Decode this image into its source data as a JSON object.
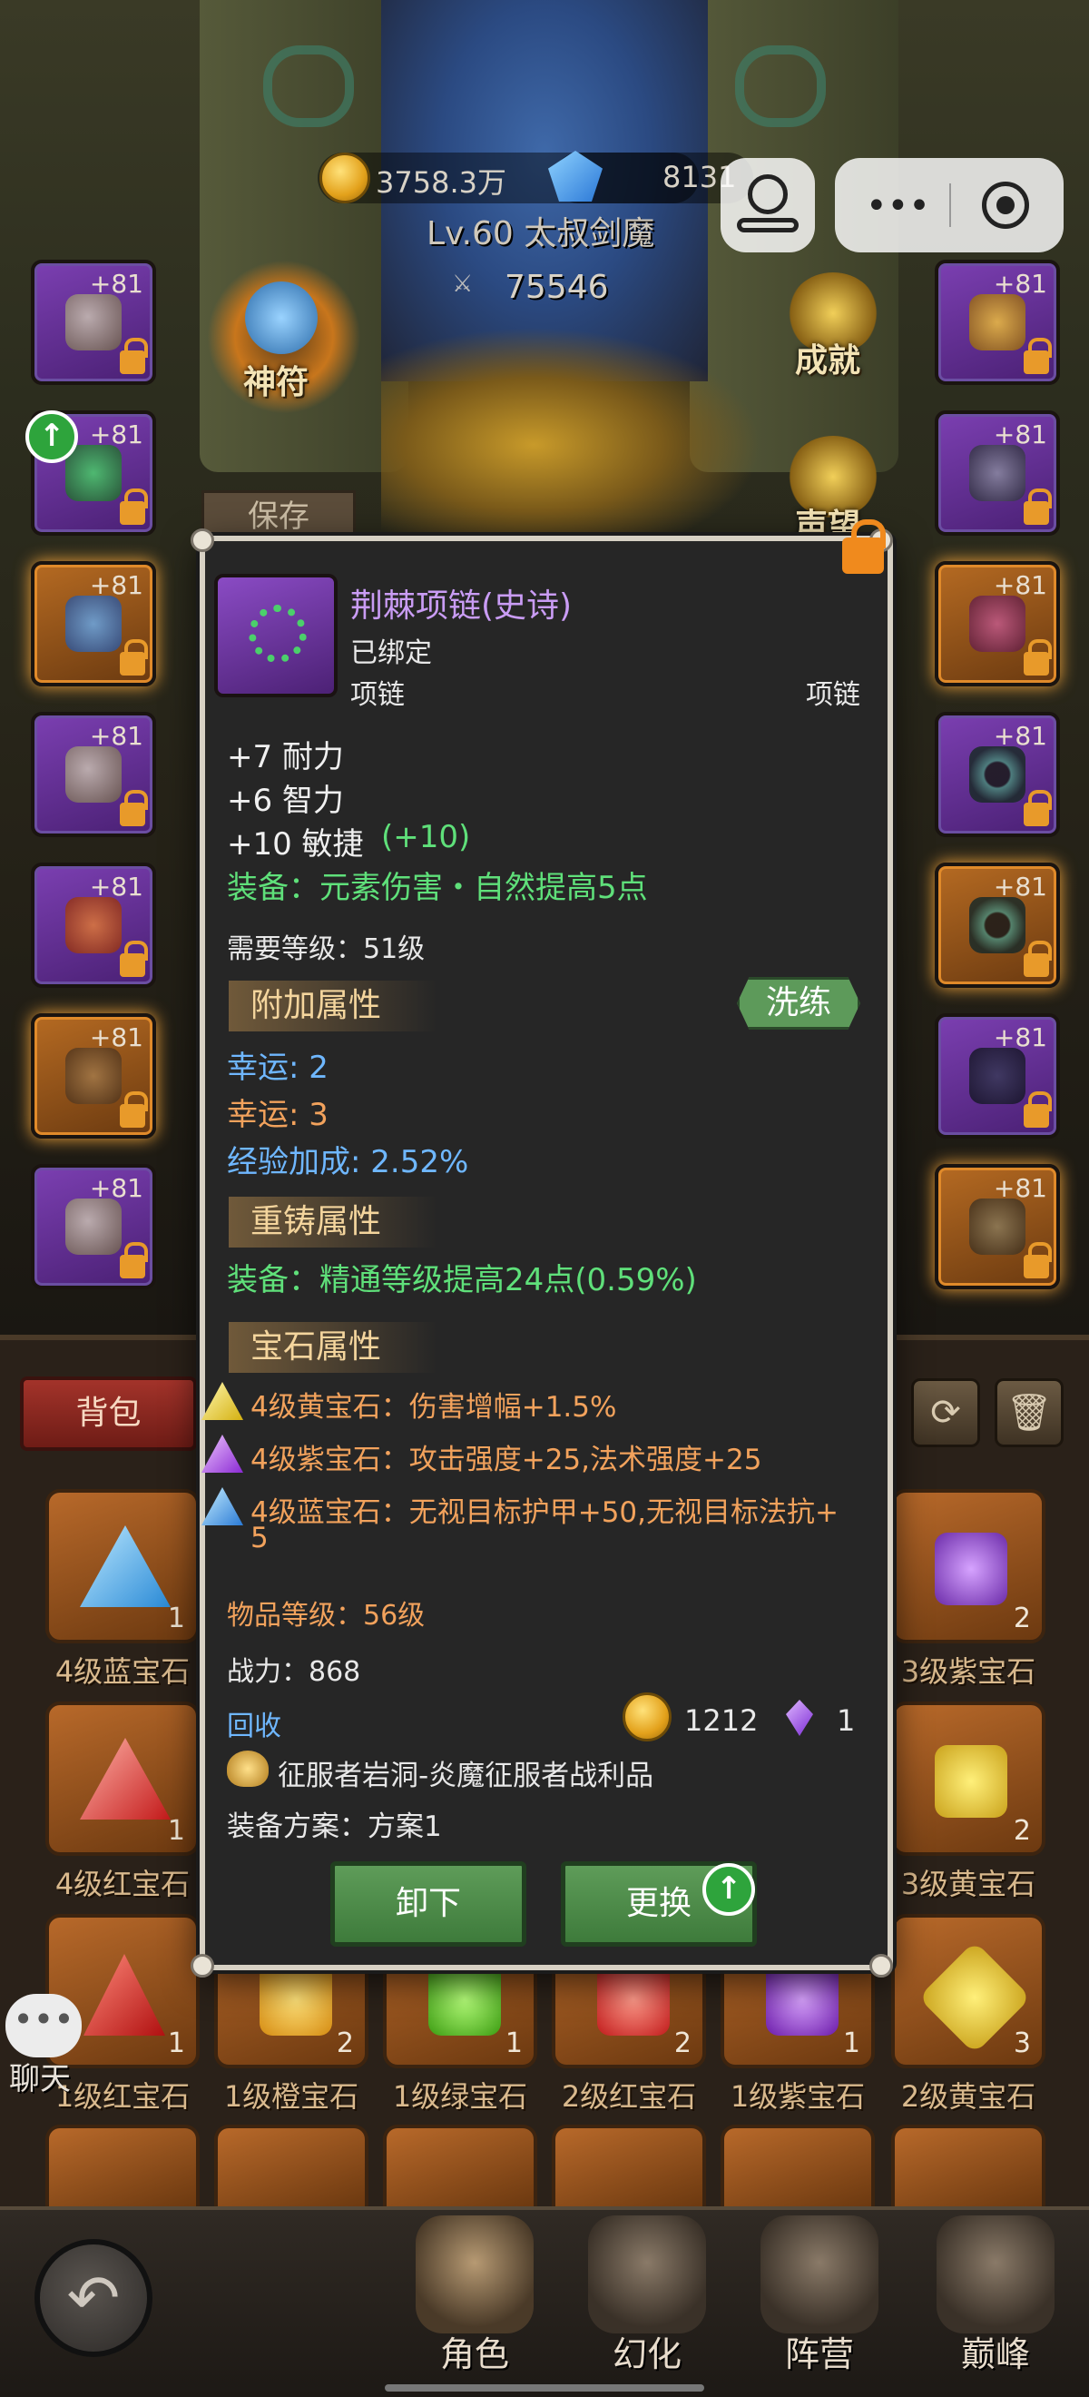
{
  "header": {
    "gold": "3758.3万",
    "gems": "8131",
    "character": "Lv.60 太叔剑魔",
    "power": "75546"
  },
  "side_buttons": {
    "rune": "神符",
    "save": "保存",
    "achievement": "成就",
    "reputation": "声望"
  },
  "slots_left": [
    "+81",
    "+81",
    "+81",
    "+81",
    "+81",
    "+81",
    "+81"
  ],
  "slots_right": [
    "+81",
    "+81",
    "+81",
    "+81",
    "+81",
    "+81",
    "+81"
  ],
  "tooltip": {
    "name": "荆棘项链(史诗)",
    "bound": "已绑定",
    "type_left": "项链",
    "type_right": "项链",
    "stats": [
      "+7 耐力",
      "+6 智力",
      "+10 敏捷"
    ],
    "stat_bonus": "(+10)",
    "equip_effect": "装备：元素伤害・自然提高5点",
    "required_level": "需要等级：51级",
    "extra_attr_title": "附加属性",
    "refine_button": "洗练",
    "extra_attrs": [
      "幸运: 2",
      "幸运: 3",
      "经验加成: 2.52%"
    ],
    "recast_title": "重铸属性",
    "recast_effect": "装备：精通等级提高24点(0.59%)",
    "gem_title": "宝石属性",
    "gems": [
      "4级黄宝石：伤害增幅+1.5%",
      "4级紫宝石：攻击强度+25,法术强度+25",
      "4级蓝宝石：无视目标护甲+50,无视目标法抗+",
      "5"
    ],
    "item_level": "物品等级：56级",
    "combat_power": "战力：868",
    "recycle": "回收",
    "recycle_gold": "1212",
    "recycle_crystal": "1",
    "source": "征服者岩洞-炎魔征服者战利品",
    "plan": "装备方案：方案1",
    "unequip_button": "卸下",
    "replace_button": "更换"
  },
  "inventory": {
    "tab": "背包",
    "row1": [
      {
        "name": "4级蓝宝石",
        "count": "1"
      },
      {
        "name": "3级紫宝石",
        "count": "2"
      }
    ],
    "row2": [
      {
        "name": "4级红宝石",
        "count": "1"
      },
      {
        "name": "3级黄宝石",
        "count": "2"
      }
    ],
    "row3": [
      {
        "name": "1级红宝石",
        "count": "1"
      },
      {
        "name": "1级橙宝石",
        "count": "2"
      },
      {
        "name": "1级绿宝石",
        "count": "1"
      },
      {
        "name": "2级红宝石",
        "count": "2"
      },
      {
        "name": "1级紫宝石",
        "count": "1"
      },
      {
        "name": "2级黄宝石",
        "count": "3"
      }
    ]
  },
  "chat_label": "聊天",
  "nav": [
    "角色",
    "幻化",
    "阵营",
    "巅峰"
  ],
  "colors": {
    "epic_purple": "#c99cf4",
    "green_text": "#5fe07a",
    "blue_text": "#6fb7ff",
    "orange_text": "#f2a25c",
    "gold_text": "#f4d59d"
  }
}
